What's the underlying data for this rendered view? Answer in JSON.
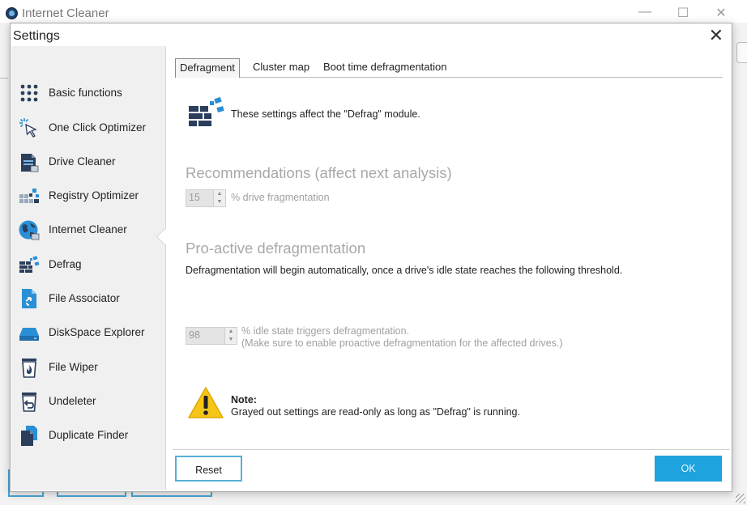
{
  "app": {
    "title": "Internet Cleaner",
    "controls": {
      "minimize": "—",
      "maximize": "☐",
      "close": "✕"
    }
  },
  "dialog": {
    "title": "Settings",
    "close": "✕"
  },
  "sidebar": {
    "items": [
      {
        "label": "Basic functions",
        "icon": "grid-dots-icon"
      },
      {
        "label": "One Click Optimizer",
        "icon": "cursor-sparkle-icon"
      },
      {
        "label": "Drive Cleaner",
        "icon": "drive-cleaner-icon"
      },
      {
        "label": "Registry Optimizer",
        "icon": "registry-icon"
      },
      {
        "label": "Internet Cleaner",
        "icon": "globe-icon"
      },
      {
        "label": "Defrag",
        "icon": "defrag-icon"
      },
      {
        "label": "File Associator",
        "icon": "file-associator-icon"
      },
      {
        "label": "DiskSpace Explorer",
        "icon": "disk-icon"
      },
      {
        "label": "File Wiper",
        "icon": "trash-fire-icon"
      },
      {
        "label": "Undeleter",
        "icon": "trash-restore-icon"
      },
      {
        "label": "Duplicate Finder",
        "icon": "duplicate-files-icon"
      }
    ],
    "selected": "Defrag"
  },
  "tabs": [
    {
      "label": "Defragment",
      "active": true
    },
    {
      "label": "Cluster map",
      "active": false
    },
    {
      "label": "Boot time defragmentation",
      "active": false
    }
  ],
  "main": {
    "info_text": "These settings affect the \"Defrag\" module.",
    "recommendations": {
      "title": "Recommendations (affect next analysis)",
      "value": "15",
      "suffix": "% drive fragmentation"
    },
    "proactive": {
      "title": "Pro-active defragmentation",
      "description": "Defragmentation will begin automatically, once a drive's idle state reaches the following threshold.",
      "value": "98",
      "line1": "% idle state triggers defragmentation.",
      "line2": "(Make sure to enable proactive defragmentation for the affected drives.)"
    },
    "note": {
      "label": "Note:",
      "text": "Grayed out settings are read-only as long as \"Defrag\" is running."
    }
  },
  "footer": {
    "reset_label": "Reset",
    "ok_label": "OK"
  },
  "colors": {
    "accent": "#1ea3de",
    "accent_border": "#56aed8",
    "disabled_text": "#a0a0a0"
  }
}
